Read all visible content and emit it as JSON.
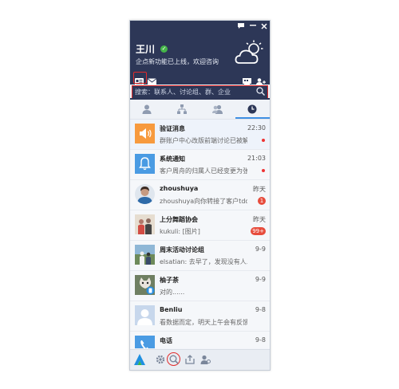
{
  "user": {
    "name": "王川",
    "signature": "企点新功能已上线，欢迎咨询"
  },
  "search": {
    "placeholder": "搜索：联系人、讨论组、群、企业"
  },
  "tabs": [
    {
      "name": "contacts",
      "icon": "person-icon"
    },
    {
      "name": "organization",
      "icon": "org-tree-icon"
    },
    {
      "name": "groups",
      "icon": "group-icon"
    },
    {
      "name": "recent",
      "icon": "clock-icon",
      "active": true
    }
  ],
  "conversations": [
    {
      "name": "验证消息",
      "message": "群账户中心改版前端讨论已被解散",
      "time": "22:30",
      "indicator": "dot",
      "avatar": "speaker-icon"
    },
    {
      "name": "系统通知",
      "message": "客户周舟的归属人已经变更为张三",
      "time": "21:03",
      "indicator": "dot",
      "avatar": "bell-icon"
    },
    {
      "name": "zhoushuya",
      "message": "zhoushuya向你转接了客户tdd...",
      "time": "昨天",
      "badge": "1",
      "avatar": "person-photo"
    },
    {
      "name": "上分舞蹈协会",
      "message": "kukuli: [图片]",
      "time": "昨天",
      "badge": "99+",
      "avatar": "group-photo"
    },
    {
      "name": "周末活动讨论组",
      "message": "elsatian: 去早了，发现没有人...",
      "time": "9-9",
      "avatar": "group-photo"
    },
    {
      "name": "柚子茶",
      "message": "对的......",
      "time": "9-9",
      "avatar": "cat-photo"
    },
    {
      "name": "Benliu",
      "message": "看数据而定，明天上午会有反馈",
      "time": "9-8",
      "avatar": "default-avatar"
    },
    {
      "name": "电话",
      "message": "",
      "time": "9-8",
      "avatar": "phone-icon"
    }
  ],
  "colors": {
    "header": "#2d3757",
    "accent": "#3f8fe3",
    "badge": "#e74c3c",
    "highlight": "#e22b2b"
  }
}
